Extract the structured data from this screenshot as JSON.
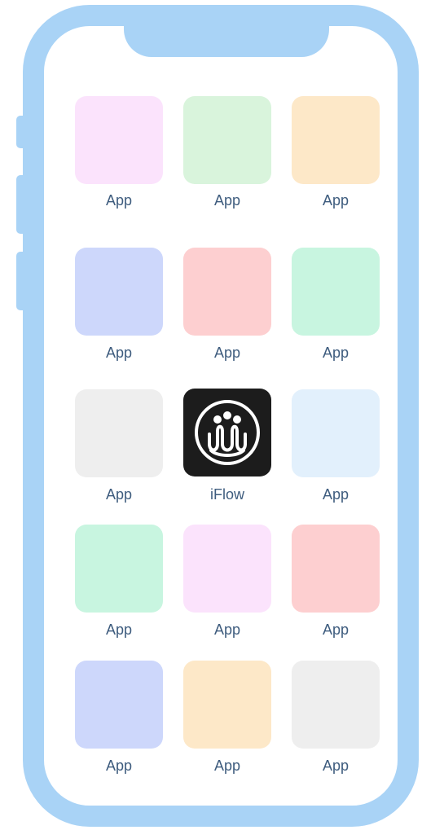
{
  "apps": [
    {
      "label": "App",
      "icon_color": "#fbe3fc",
      "icon": "blank-app-icon"
    },
    {
      "label": "App",
      "icon_color": "#d9f4dc",
      "icon": "blank-app-icon"
    },
    {
      "label": "App",
      "icon_color": "#fde8c8",
      "icon": "blank-app-icon"
    },
    {
      "label": "App",
      "icon_color": "#cdd7fb",
      "icon": "blank-app-icon"
    },
    {
      "label": "App",
      "icon_color": "#fdcfd0",
      "icon": "blank-app-icon"
    },
    {
      "label": "App",
      "icon_color": "#c8f5e0",
      "icon": "blank-app-icon"
    },
    {
      "label": "App",
      "icon_color": "#eeeeee",
      "icon": "blank-app-icon"
    },
    {
      "label": "iFlow",
      "icon_color": "#1c1c1c",
      "icon": "iflow-logo-icon"
    },
    {
      "label": "App",
      "icon_color": "#e2f0fc",
      "icon": "blank-app-icon"
    },
    {
      "label": "App",
      "icon_color": "#c8f5e0",
      "icon": "blank-app-icon"
    },
    {
      "label": "App",
      "icon_color": "#fbe3fc",
      "icon": "blank-app-icon"
    },
    {
      "label": "App",
      "icon_color": "#fdcfd0",
      "icon": "blank-app-icon"
    },
    {
      "label": "App",
      "icon_color": "#cdd7fb",
      "icon": "blank-app-icon"
    },
    {
      "label": "App",
      "icon_color": "#fde8c8",
      "icon": "blank-app-icon"
    },
    {
      "label": "App",
      "icon_color": "#eeeeee",
      "icon": "blank-app-icon"
    }
  ],
  "colors": {
    "phone_frame": "#a9d3f6",
    "label_text": "#3e5c7e"
  }
}
